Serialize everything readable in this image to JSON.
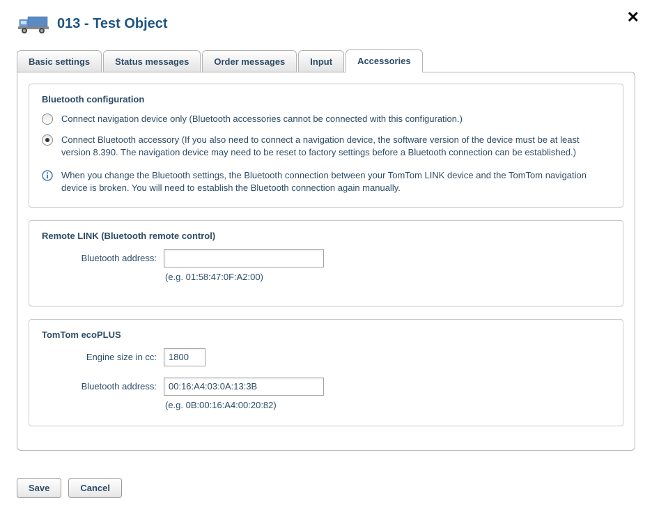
{
  "header": {
    "title": "013 - Test Object"
  },
  "tabs": [
    {
      "label": "Basic settings",
      "active": false
    },
    {
      "label": "Status messages",
      "active": false
    },
    {
      "label": "Order messages",
      "active": false
    },
    {
      "label": "Input",
      "active": false
    },
    {
      "label": "Accessories",
      "active": true
    }
  ],
  "bluetooth_config": {
    "title": "Bluetooth configuration",
    "option1": "Connect navigation device only (Bluetooth accessories cannot be connected with this configuration.)",
    "option2": "Connect Bluetooth accessory (If you also need to connect a navigation device, the software version of the device must be at least version 8.390. The navigation device may need to be reset to factory settings before a Bluetooth connection can be established.)",
    "selected": "option2",
    "info_text": "When you change the Bluetooth settings, the Bluetooth connection between your TomTom LINK device and the TomTom navigation device is broken. You will need to establish the Bluetooth connection again manually."
  },
  "remote_link": {
    "title": "Remote LINK (Bluetooth remote control)",
    "bt_address_label": "Bluetooth address:",
    "bt_address_value": "",
    "bt_address_hint": "(e.g. 01:58:47:0F:A2:00)"
  },
  "ecoplus": {
    "title": "TomTom ecoPLUS",
    "engine_label": "Engine size in cc:",
    "engine_value": "1800",
    "bt_address_label": "Bluetooth address:",
    "bt_address_value": "00:16:A4:03:0A:13:3B",
    "bt_address_hint": "(e.g. 0B:00:16:A4:00:20:82)"
  },
  "buttons": {
    "save": "Save",
    "cancel": "Cancel"
  }
}
